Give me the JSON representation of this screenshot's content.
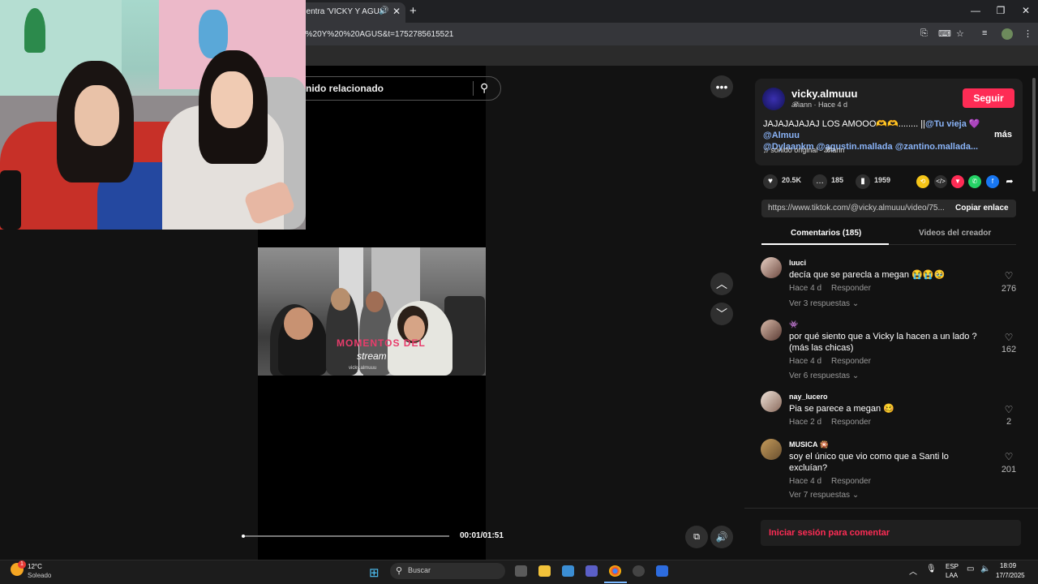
{
  "browser": {
    "tab_title": "uentra 'VICKY Y AGUS'",
    "url": "Y%20Y%20%20AGUS&t=1752785615521"
  },
  "video": {
    "search_placeholder": "nido relacionado",
    "caption_line1": "MOMENTOS DEL",
    "caption_line2": "stream",
    "caption_line3": "vicky.almuuu",
    "time": "00:01/01:51",
    "progress": 0.01
  },
  "post": {
    "username": "vicky.almuuu",
    "meta": "𝓑iann · Hace 4 d",
    "follow_label": "Seguir",
    "desc_text": "JAJAJAJAJAJ LOS AMOOO🫶🫶........ ||",
    "desc_tags": [
      "@Tu vieja",
      "💜",
      "@Almuu",
      "@Dylaankm",
      "@agustin.mallada",
      "@zantino.mallada..."
    ],
    "more_label": "más",
    "music": "sonido original - 𝓑iann",
    "likes": "20.5K",
    "comments": "185",
    "saves": "1959",
    "link": "https://www.tiktok.com/@vicky.almuuu/video/75...",
    "copy_label": "Copiar enlace",
    "tab_comments": "Comentarios (185)",
    "tab_videos": "Videos del creador",
    "accent": "#fe2c55"
  },
  "comments": [
    {
      "name": "luuci",
      "text": "decía que se parecla a megan 😭😭🥹",
      "time": "Hace 4 d",
      "reply": "Responder",
      "replies": "Ver 3 respuestas",
      "likes": "276"
    },
    {
      "name": "👾",
      "text": "por qué siento que a Vicky la hacen a un lado ? (más las chicas)",
      "time": "Hace 4 d",
      "reply": "Responder",
      "replies": "Ver 6 respuestas",
      "likes": "162"
    },
    {
      "name": "nay_lucero",
      "text": "Pia se parece a megan 🥴",
      "time": "Hace 2 d",
      "reply": "Responder",
      "replies": "",
      "likes": "2"
    },
    {
      "name": "MUSICA 🎇",
      "text": "soy el único que vio como que a Santi lo excluían?",
      "time": "Hace 4 d",
      "reply": "Responder",
      "replies": "Ver 7 respuestas",
      "likes": "201"
    }
  ],
  "login_label": "Iniciar sesión para comentar",
  "taskbar": {
    "temp": "12°C",
    "condition": "Soleado",
    "weather_badge": "1",
    "search": "Buscar",
    "lang1": "ESP",
    "lang2": "LAA",
    "time": "18:09",
    "date": "17/7/2025"
  }
}
